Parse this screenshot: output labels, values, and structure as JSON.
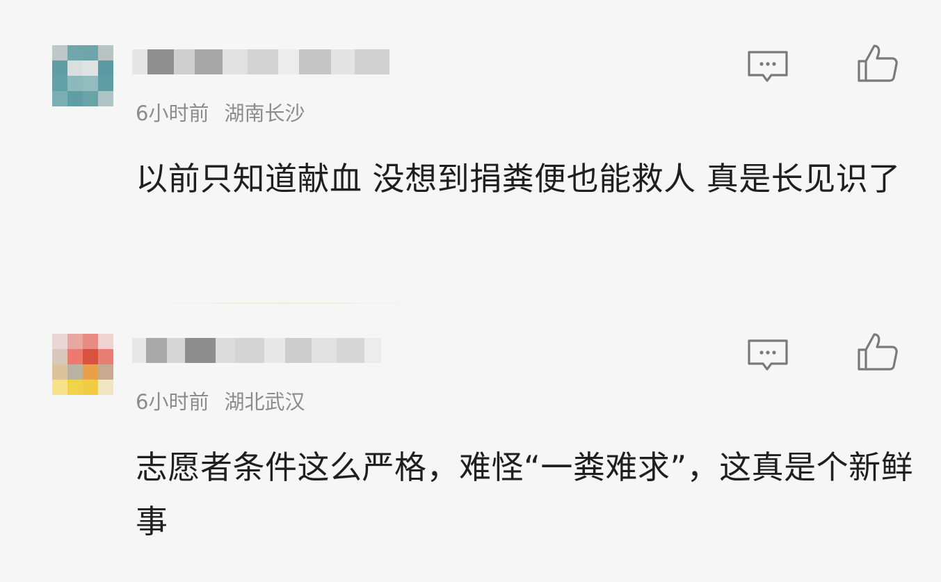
{
  "colors": {
    "background": "#f6f6f6",
    "text": "#1f1f1f",
    "meta": "#8c8c8c",
    "icon": "#7a7a7a"
  },
  "comments": [
    {
      "username": "",
      "time": "6小时前",
      "location": "湖南长沙",
      "text": "以前只知道献血 没想到捐粪便也能救人 真是长见识了",
      "avatar_icon": "avatar-icon",
      "reply_icon": "comment-bubble-icon",
      "like_icon": "thumbs-up-icon"
    },
    {
      "username": "",
      "time": "6小时前",
      "location": "湖北武汉",
      "text": "志愿者条件这么严格，难怪“一粪难求”，这真是个新鲜事",
      "avatar_icon": "avatar-icon",
      "reply_icon": "comment-bubble-icon",
      "like_icon": "thumbs-up-icon"
    }
  ]
}
